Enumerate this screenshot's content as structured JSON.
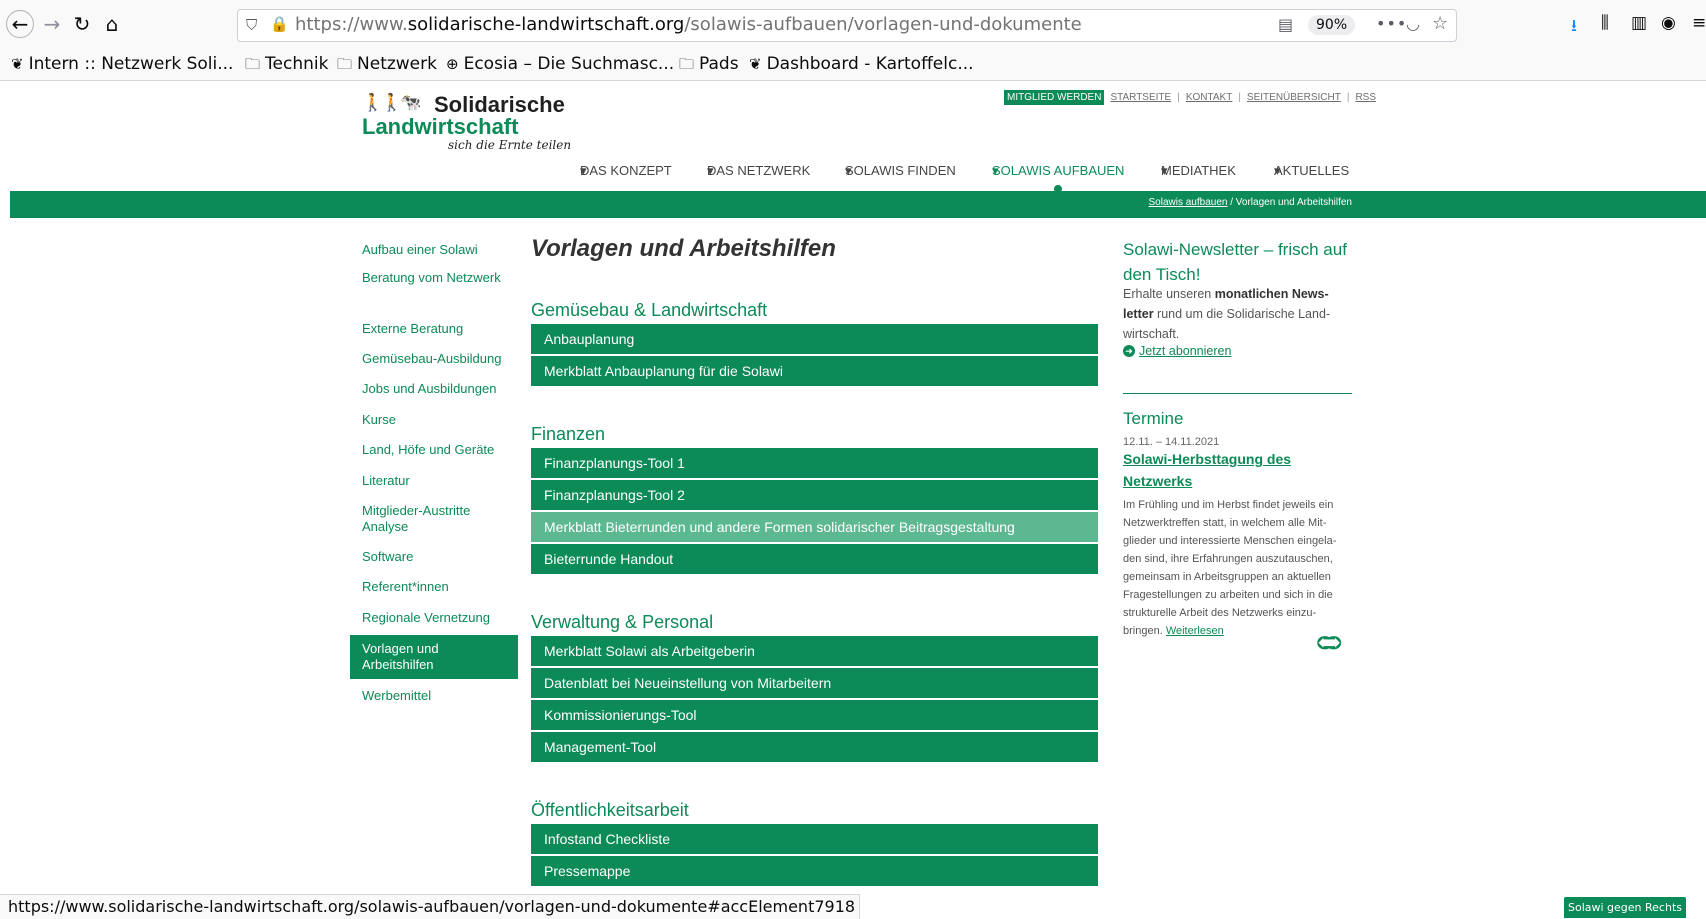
{
  "browser": {
    "url_prefix": "https://www.",
    "url_host": "solidarische-landwirtschaft.org",
    "url_path": "/solawis-aufbauen/vorlagen-und-dokumente",
    "zoom": "90%",
    "bookmarks": [
      {
        "icon": "solawi-icon",
        "glyph": "❦",
        "label": "Intern :: Netzwerk Soli..."
      },
      {
        "icon": "folder-icon",
        "glyph": "🗀",
        "label": "Technik"
      },
      {
        "icon": "folder-icon",
        "glyph": "🗀",
        "label": "Netzwerk"
      },
      {
        "icon": "globe-icon",
        "glyph": "⊕",
        "label": "Ecosia – Die Suchmasc..."
      },
      {
        "icon": "folder-icon",
        "glyph": "🗀",
        "label": "Pads"
      },
      {
        "icon": "solawi-icon",
        "glyph": "❦",
        "label": "Dashboard - Kartoffelc..."
      }
    ],
    "status_url": "https://www.solidarische-landwirtschaft.org/solawis-aufbauen/vorlagen-und-dokumente#accElement7918"
  },
  "site": {
    "logo": {
      "line1": "Solidarische",
      "line2": "Landwirtschaft",
      "tagline": "sich die Ernte teilen"
    },
    "meta_nav": {
      "member": "MITGLIED WERDEN",
      "links": [
        "STARTSEITE",
        "KONTAKT",
        "SEITENÜBERSICHT",
        "RSS"
      ]
    },
    "main_nav": [
      {
        "label": "DAS KONZEPT",
        "active": false
      },
      {
        "label": "DAS NETZWERK",
        "active": false
      },
      {
        "label": "SOLAWIS FINDEN",
        "active": false
      },
      {
        "label": "SOLAWIS AUFBAUEN",
        "active": true
      },
      {
        "label": "MEDIATHEK",
        "active": false
      },
      {
        "label": "AKTUELLES",
        "active": false
      }
    ],
    "breadcrumb": {
      "parent": "Solawis aufbauen",
      "separator": "/",
      "current": "Vorlagen und Arbeitshilfen"
    },
    "colors": {
      "brand": "#0c8a57",
      "hover": "#5cb891"
    },
    "subnav": [
      {
        "label": "Aufbau einer Solawi",
        "active": false
      },
      {
        "label": "Beratung vom Netzwerk",
        "active": false
      },
      {
        "label": "Externe Beratung",
        "active": false
      },
      {
        "label": "Gemüsebau-Ausbildung",
        "active": false
      },
      {
        "label": "Jobs und Ausbildungen",
        "active": false
      },
      {
        "label": "Kurse",
        "active": false
      },
      {
        "label": "Land, Höfe und Geräte",
        "active": false
      },
      {
        "label": "Literatur",
        "active": false
      },
      {
        "label": "Mitglieder-Austritte Analyse",
        "active": false
      },
      {
        "label": "Software",
        "active": false
      },
      {
        "label": "Referent*innen",
        "active": false
      },
      {
        "label": "Regionale Vernetzung",
        "active": false
      },
      {
        "label": "Vorlagen und Arbeitshilfen",
        "active": true
      },
      {
        "label": "Werbemittel",
        "active": false
      }
    ],
    "page_title": "Vorlagen und Arbeitshilfen",
    "sections": [
      {
        "title": "Gemüsebau & Landwirtschaft",
        "items": [
          "Anbauplanung",
          "Merkblatt Anbauplanung für die Solawi"
        ]
      },
      {
        "title": "Finanzen",
        "items": [
          "Finanzplanungs-Tool 1",
          "Finanzplanungs-Tool 2",
          "Merkblatt Bieterrunden und andere Formen solidarischer Beitragsgestaltung",
          "Bieterrunde Handout"
        ]
      },
      {
        "title": "Verwaltung & Personal",
        "items": [
          "Merkblatt Solawi als Arbeitgeberin",
          "Datenblatt bei Neueinstellung von Mitarbeitern",
          "Kommissionierungs-Tool",
          "Management-Tool"
        ]
      },
      {
        "title": "Öffentlichkeitsarbeit",
        "items": [
          "Infostand Checkliste",
          "Pressemappe"
        ]
      }
    ],
    "newsletter": {
      "title": "Solawi-Newsletter – frisch auf den Tisch!",
      "text_a": "Erhalte unseren ",
      "text_bold": "monatlichen News-letter",
      "text_b": " rund um die Solidarische Land-wirtschaft.",
      "link": "Jetzt abonnieren"
    },
    "events": {
      "title": "Termine",
      "date": "12.11. – 14.11.2021",
      "name": "Solawi-Herbsttagung des Netzwerks",
      "text": "Im Frühling und im Herbst findet jeweils ein Netzwerktreffen statt, in welchem alle Mit-glieder und interessierte Menschen eingela-den sind, ihre Erfahrungen auszutauschen, gemeinsam in Arbeitsgruppen an aktuellen Fragestellungen zu arbeiten und sich in die strukturelle Arbeit des Netzwerks einzu-bringen. ",
      "more": "Weiterlesen"
    },
    "legal_button": "Solawi gegen Rechts"
  }
}
